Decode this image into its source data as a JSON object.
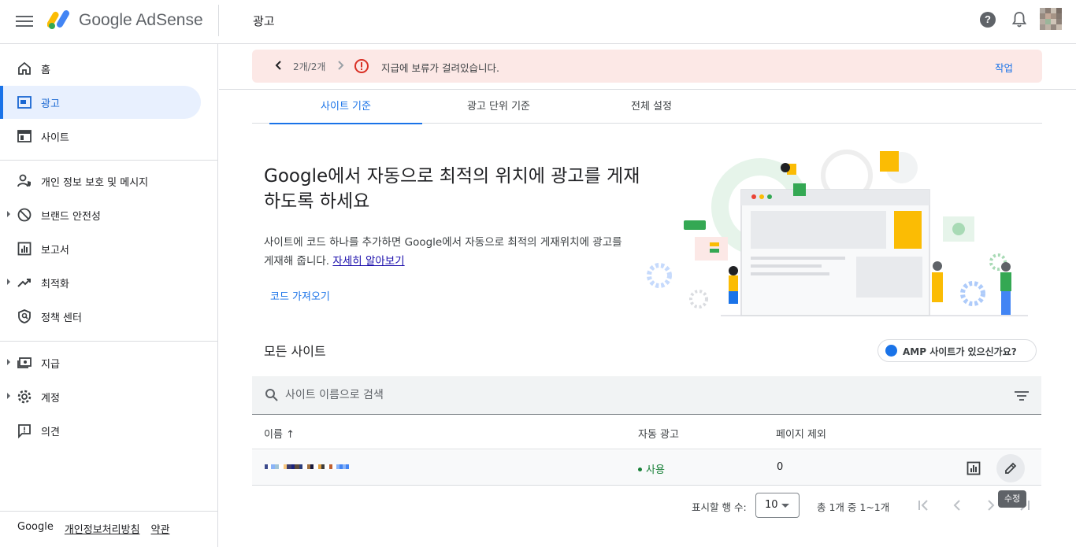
{
  "header": {
    "brand": "Google AdSense",
    "page_title": "광고",
    "help_glyph": "?"
  },
  "sidebar": {
    "items": [
      {
        "label": "홈",
        "icon": "home-icon"
      },
      {
        "label": "광고",
        "icon": "ads-icon",
        "active": true
      },
      {
        "label": "사이트",
        "icon": "sites-icon"
      },
      {
        "label": "개인 정보 보호 및 메시지",
        "icon": "privacy-icon"
      },
      {
        "label": "브랜드 안전성",
        "icon": "block-icon",
        "expandable": true
      },
      {
        "label": "보고서",
        "icon": "reports-icon"
      },
      {
        "label": "최적화",
        "icon": "trending-up-icon",
        "expandable": true
      },
      {
        "label": "정책 센터",
        "icon": "policy-icon"
      },
      {
        "label": "지급",
        "icon": "payments-icon",
        "expandable": true
      },
      {
        "label": "계정",
        "icon": "gear-icon",
        "expandable": true
      },
      {
        "label": "의견",
        "icon": "feedback-icon"
      }
    ],
    "footer": {
      "google": "Google",
      "privacy": "개인정보처리방침",
      "terms": "약관"
    }
  },
  "banner": {
    "count": "2개/2개",
    "message": "지급에 보류가 걸려있습니다.",
    "action": "작업"
  },
  "tabs": [
    {
      "label": "사이트 기준",
      "active": true
    },
    {
      "label": "광고 단위 기준"
    },
    {
      "label": "전체 설정"
    }
  ],
  "hero": {
    "title": "Google에서 자동으로 최적의 위치에 광고를 게재하도록 하세요",
    "description": "사이트에 코드 하나를 추가하면 Google에서 자동으로 최적의 게재위치에 광고를 게재해 줍니다. ",
    "learn_more": "자세히 알아보기",
    "code_button": "코드 가져오기"
  },
  "sites": {
    "heading": "모든 사이트",
    "amp_chip": "AMP 사이트가 있으신가요?",
    "search_placeholder": "사이트 이름으로 검색",
    "columns": {
      "name": "이름",
      "sort_arrow": "↑",
      "auto_ads": "자동 광고",
      "page_exclusions": "페이지 제외"
    },
    "rows": [
      {
        "status": "사용",
        "exclusions": "0"
      }
    ],
    "edit_tooltip": "수정"
  },
  "pagination": {
    "rows_label": "표시할 행 수:",
    "rows_value": "10",
    "range": "총 1개 중 1~1개"
  },
  "colors": {
    "accent": "#1a73e8",
    "banner_bg": "#fce8e6",
    "error": "#d93025",
    "status_green": "#188038"
  }
}
